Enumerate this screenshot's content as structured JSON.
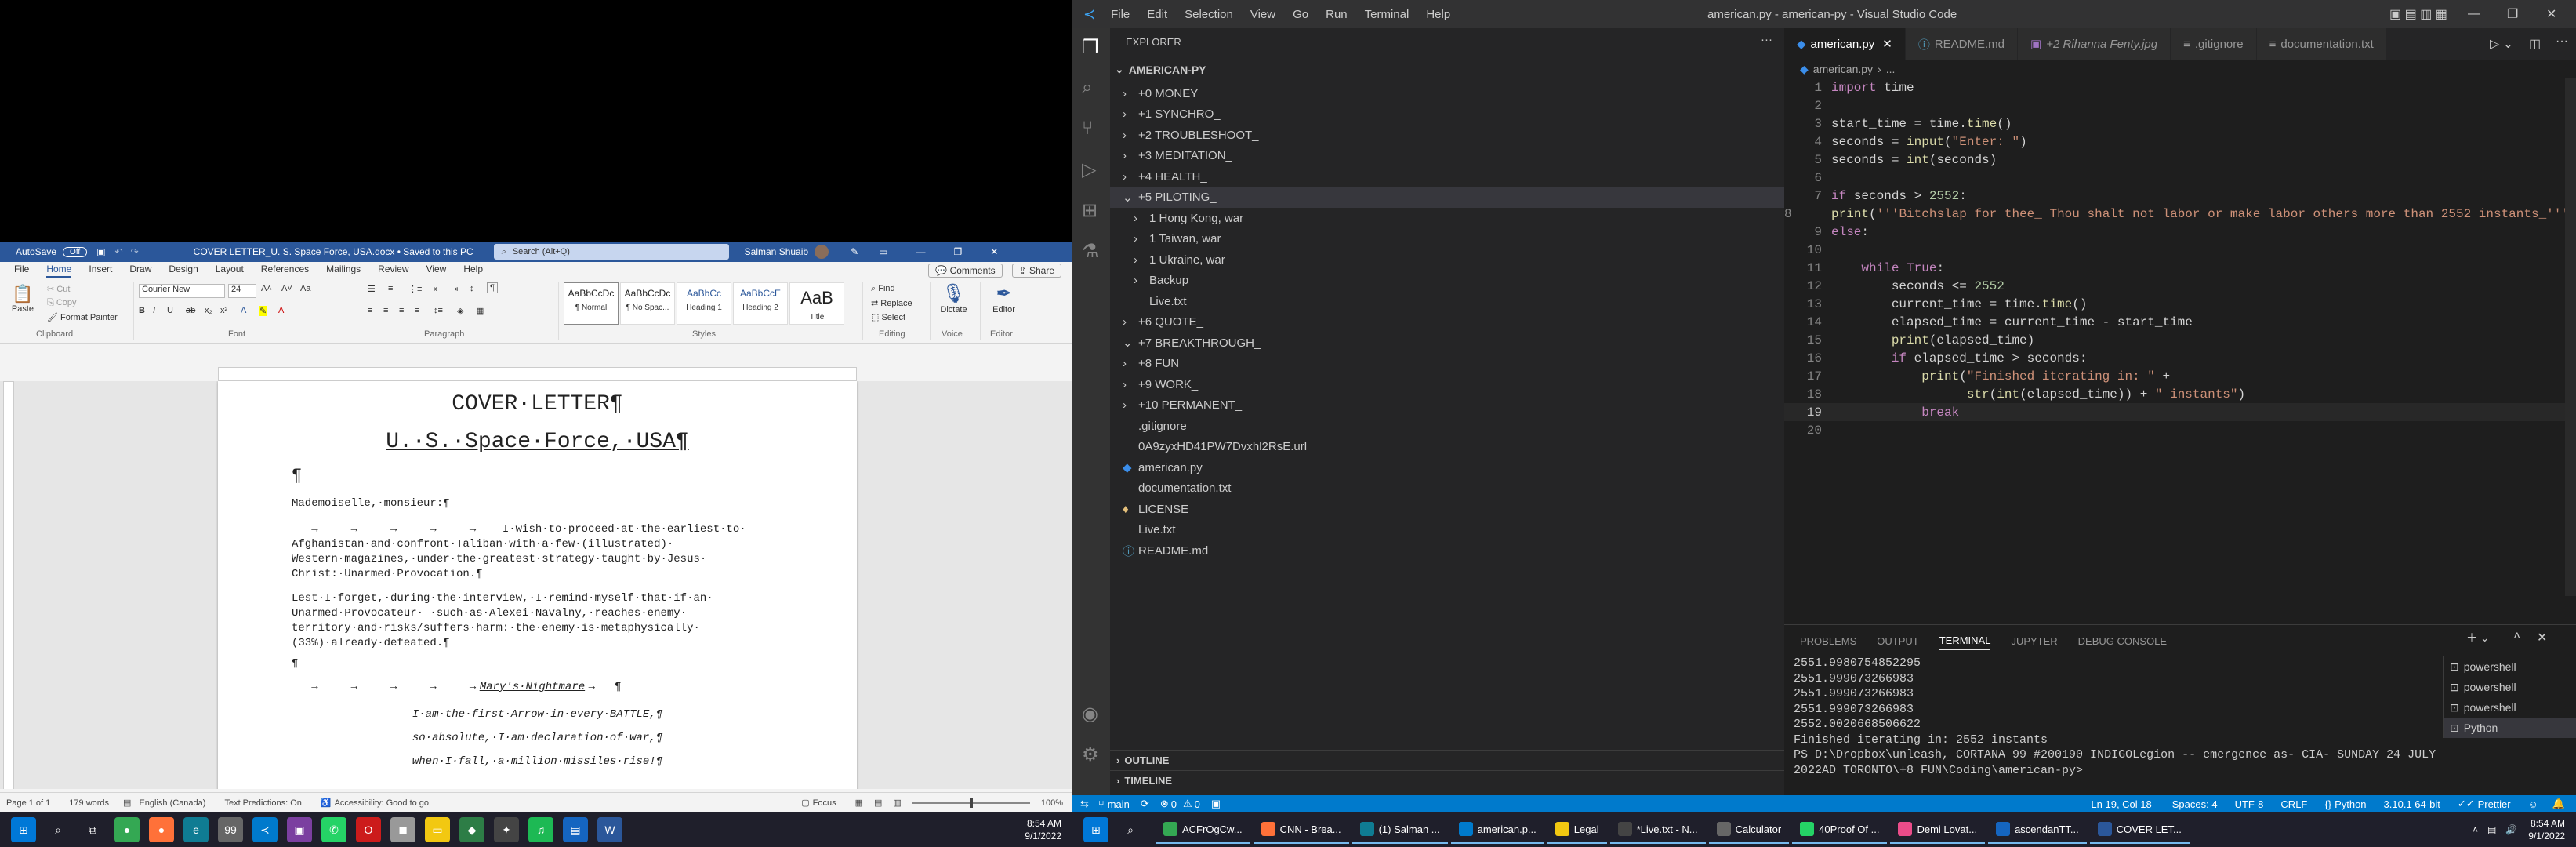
{
  "word": {
    "autosave_label": "AutoSave",
    "autosave_state": "Off",
    "title": "COVER LETTER_U. S. Space Force, USA.docx • Saved to this PC",
    "search_placeholder": "Search (Alt+Q)",
    "user": "Salman Shuaib",
    "tabs": [
      "File",
      "Home",
      "Insert",
      "Draw",
      "Design",
      "Layout",
      "References",
      "Mailings",
      "Review",
      "View",
      "Help"
    ],
    "comments_label": "Comments",
    "share_label": "Share",
    "clipboard": {
      "paste": "Paste",
      "cut": "Cut",
      "copy": "Copy",
      "format_painter": "Format Painter",
      "group": "Clipboard"
    },
    "font": {
      "name": "Courier New",
      "size": "24",
      "group": "Font"
    },
    "paragraph_group": "Paragraph",
    "styles": [
      {
        "preview": "AaBbCcDc",
        "name": "¶ Normal"
      },
      {
        "preview": "AaBbCcDc",
        "name": "¶ No Spac..."
      },
      {
        "preview": "AaBbCc",
        "name": "Heading 1"
      },
      {
        "preview": "AaBbCcE",
        "name": "Heading 2"
      },
      {
        "preview": "AaB",
        "name": "Title"
      }
    ],
    "styles_group": "Styles",
    "editing": {
      "find": "Find",
      "replace": "Replace",
      "select": "Select",
      "group": "Editing"
    },
    "voice": {
      "dictate": "Dictate",
      "group": "Voice"
    },
    "editor": {
      "label": "Editor",
      "group": "Editor"
    },
    "doc": {
      "title": "COVER·LETTER¶",
      "subtitle": "U.·S.·Space·Force,·USA¶",
      "empty_para": "¶",
      "salutation": "Mademoiselle,·monsieur:¶",
      "para1": [
        "   →     →     →     →     →    I·wish·to·proceed·at·the·earliest·to·",
        "Afghanistan·and·confront·Taliban·with·a·few·(illustrated)·",
        "Western·magazines,·under·the·greatest·strategy·taught·by·Jesus·",
        "Christ:·Unarmed·Provocation.¶"
      ],
      "para2": [
        "Lest·I·forget,·during·the·interview,·I·remind·myself·that·if·an·",
        "Unarmed·Provocateur·–·such·as·Alexei·Navalny,·reaches·enemy·",
        "territory·and·risks/suffers·harm:·the·enemy·is·metaphysically·",
        "(33%)·already·defeated.¶"
      ],
      "empty_para2": "¶",
      "poem_heading_arrows": "   →     →     →     →     →",
      "poem_title": "Mary's·Nightmare",
      "poem_title_suffix": "→   ¶",
      "poem": [
        "I·am·the·first·Arrow·in·every·BATTLE,¶",
        "so·absolute,·I·am·declaration·of·war,¶",
        "when·I·fall,·a·million·missiles·rise!¶"
      ]
    },
    "status": {
      "page": "Page 1 of 1",
      "words": "179 words",
      "language": "English (Canada)",
      "text_predictions": "Text Predictions: On",
      "accessibility": "Accessibility: Good to go",
      "focus": "Focus",
      "zoom": "100%"
    }
  },
  "vscode": {
    "menu": [
      "File",
      "Edit",
      "Selection",
      "View",
      "Go",
      "Run",
      "Terminal",
      "Help"
    ],
    "title": "american.py - american-py - Visual Studio Code",
    "explorer_label": "EXPLORER",
    "root": "AMERICAN-PY",
    "tree": [
      {
        "label": "+0 MONEY",
        "kind": "folder",
        "depth": 1,
        "open": false
      },
      {
        "label": "+1 SYNCHRO_",
        "kind": "folder",
        "depth": 1,
        "open": false
      },
      {
        "label": "+2 TROUBLESHOOT_",
        "kind": "folder",
        "depth": 1,
        "open": false
      },
      {
        "label": "+3 MEDITATION_",
        "kind": "folder",
        "depth": 1,
        "open": false
      },
      {
        "label": "+4 HEALTH_",
        "kind": "folder",
        "depth": 1,
        "open": false
      },
      {
        "label": "+5 PILOTING_",
        "kind": "folder",
        "depth": 1,
        "open": true,
        "selected": true
      },
      {
        "label": "1 Hong Kong, war",
        "kind": "folder",
        "depth": 2,
        "open": false
      },
      {
        "label": "1 Taiwan, war",
        "kind": "folder",
        "depth": 2,
        "open": false
      },
      {
        "label": "1 Ukraine, war",
        "kind": "folder",
        "depth": 2,
        "open": false
      },
      {
        "label": "Backup",
        "kind": "folder",
        "depth": 2,
        "open": false
      },
      {
        "label": "Live.txt",
        "kind": "file",
        "depth": 2
      },
      {
        "label": "+6 QUOTE_",
        "kind": "folder",
        "depth": 1,
        "open": false
      },
      {
        "label": "+7 BREAKTHROUGH_",
        "kind": "folder",
        "depth": 1,
        "open": true
      },
      {
        "label": "+8 FUN_",
        "kind": "folder",
        "depth": 1,
        "open": false
      },
      {
        "label": "+9 WORK_",
        "kind": "folder",
        "depth": 1,
        "open": false
      },
      {
        "label": "+10 PERMANENT_",
        "kind": "folder",
        "depth": 1,
        "open": false
      },
      {
        "label": ".gitignore",
        "kind": "file",
        "depth": 1
      },
      {
        "label": "0A9zyxHD41PW7Dvxhl2RsE.url",
        "kind": "file",
        "depth": 1
      },
      {
        "label": "american.py",
        "kind": "py",
        "depth": 1
      },
      {
        "label": "documentation.txt",
        "kind": "file",
        "depth": 1
      },
      {
        "label": "LICENSE",
        "kind": "license",
        "depth": 1
      },
      {
        "label": "Live.txt",
        "kind": "file",
        "depth": 1
      },
      {
        "label": "README.md",
        "kind": "md",
        "depth": 1
      }
    ],
    "outline_label": "OUTLINE",
    "timeline_label": "TIMELINE",
    "tabs": [
      {
        "label": "american.py",
        "active": true
      },
      {
        "label": "README.md",
        "active": false
      },
      {
        "label": "+2 Rihanna Fenty.jpg",
        "active": false
      },
      {
        "label": ".gitignore",
        "active": false
      },
      {
        "label": "documentation.txt",
        "active": false
      }
    ],
    "breadcrumb": [
      "american.py",
      "..."
    ],
    "code": [
      "import time",
      "",
      "start_time = time.time()",
      "seconds = input(\"Enter: \")",
      "seconds = int(seconds)",
      "",
      "if seconds > 2552:",
      "    print('''Bitchslap for thee_ Thou shalt not labor or make labor others more than 2552 instants_''')",
      "else:",
      "",
      "    while True:",
      "        seconds <= 2552",
      "        current_time = time.time()",
      "        elapsed_time = current_time - start_time",
      "        print(elapsed_time)",
      "        if elapsed_time > seconds:",
      "            print(\"Finished iterating in: \" +",
      "                  str(int(elapsed_time)) + \" instants\")",
      "            break",
      ""
    ],
    "panel_tabs": [
      "PROBLEMS",
      "OUTPUT",
      "TERMINAL",
      "JUPYTER",
      "DEBUG CONSOLE"
    ],
    "active_panel_tab": "TERMINAL",
    "terminal": [
      "2551.9980754852295",
      "2551.999073266983",
      "2551.999073266983",
      "2551.999073266983",
      "2552.0020668506622",
      "Finished iterating in: 2552 instants",
      "PS D:\\Dropbox\\unleash, CORTANA 99 #200190 INDIGOLegion -- emergence as- CIA- SUNDAY 24 JULY",
      "2022AD TORONTO\\+8 FUN\\Coding\\american-py> "
    ],
    "terminals": [
      "powershell",
      "powershell",
      "powershell",
      "Python"
    ],
    "status": {
      "branch": "main",
      "errors": "0",
      "warnings": "0",
      "position": "Ln 19, Col 18",
      "spaces": "Spaces: 4",
      "encoding": "UTF-8",
      "eol": "CRLF",
      "language": "Python",
      "interpreter": "3.10.1 64-bit",
      "prettier": "Prettier"
    }
  },
  "taskbar": {
    "left_time": "8:54 AM",
    "left_date": "9/1/2022",
    "right_time": "8:54 AM",
    "right_date": "9/1/2022",
    "right_apps": [
      "ACFrOgCw...",
      "CNN - Brea...",
      "(1) Salman ...",
      "american.p...",
      "Legal",
      "*Live.txt - N...",
      "Calculator",
      "40Proof Of ...",
      "Demi Lovat...",
      "ascendanTT...",
      "COVER LET..."
    ]
  },
  "colors": {
    "word_blue": "#2b579a",
    "vscode_status": "#007acc",
    "keyword": "#c586c0",
    "string": "#ce9178",
    "function": "#dcdcaa",
    "variable": "#9cdcfe",
    "number": "#b5cea8"
  }
}
